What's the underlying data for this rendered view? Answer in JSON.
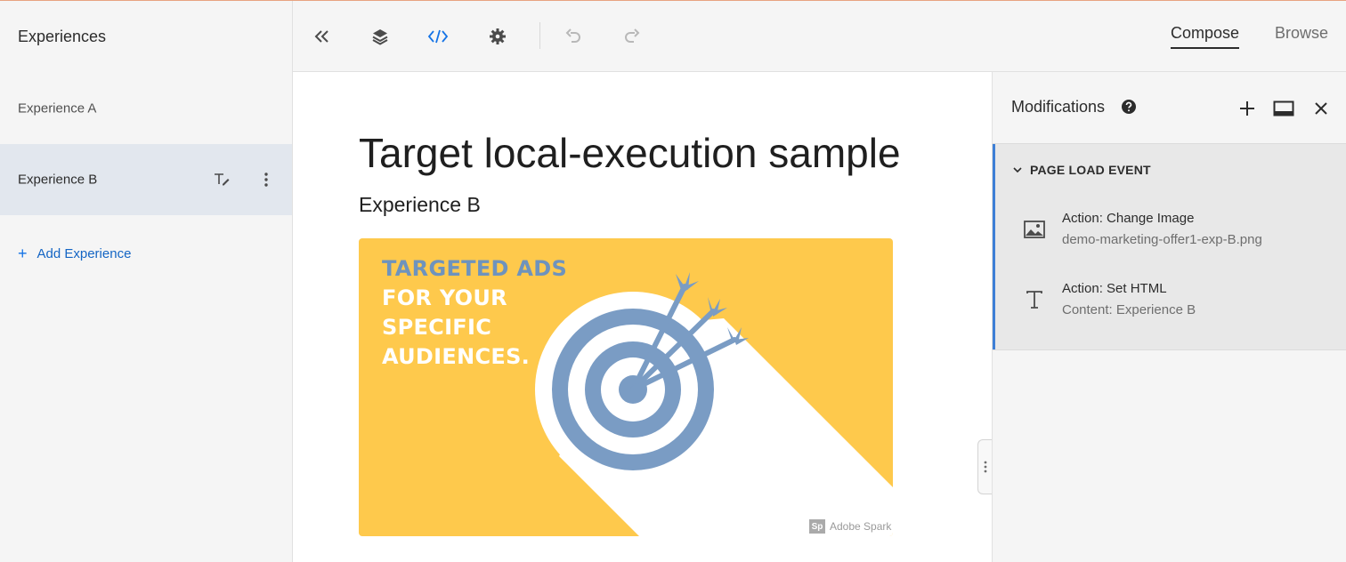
{
  "sidebar": {
    "title": "Experiences",
    "experiences": [
      {
        "label": "Experience A"
      },
      {
        "label": "Experience B"
      }
    ],
    "add_label": "Add Experience"
  },
  "toolbar": {
    "icons": [
      "collapse-left-icon",
      "layers-icon",
      "code-icon",
      "gear-icon",
      "undo-icon",
      "redo-icon"
    ],
    "tabs": [
      {
        "label": "Compose",
        "active": true
      },
      {
        "label": "Browse",
        "active": false
      }
    ]
  },
  "canvas": {
    "heading": "Target local-execution sample",
    "subheading": "Experience B",
    "banner": {
      "lines": [
        "TARGETED ADS",
        "FOR YOUR",
        "SPECIFIC",
        "AUDIENCES."
      ],
      "brand": "Adobe Spark",
      "brand_badge": "Sp",
      "colors": {
        "background": "#fec94c",
        "target": "#7a9cc4",
        "heading_accent": "#6e93bd"
      }
    }
  },
  "modifications": {
    "title": "Modifications",
    "group": "PAGE LOAD EVENT",
    "actions": [
      {
        "icon": "image-icon",
        "title": "Action: Change Image",
        "detail": "demo-marketing-offer1-exp-B.png"
      },
      {
        "icon": "text-icon",
        "title": "Action: Set HTML",
        "detail": "Content: Experience B"
      }
    ]
  },
  "colors": {
    "accent": "#1473e6",
    "selected_row": "#e2e7ee",
    "group_bar": "#3e7fd6"
  }
}
